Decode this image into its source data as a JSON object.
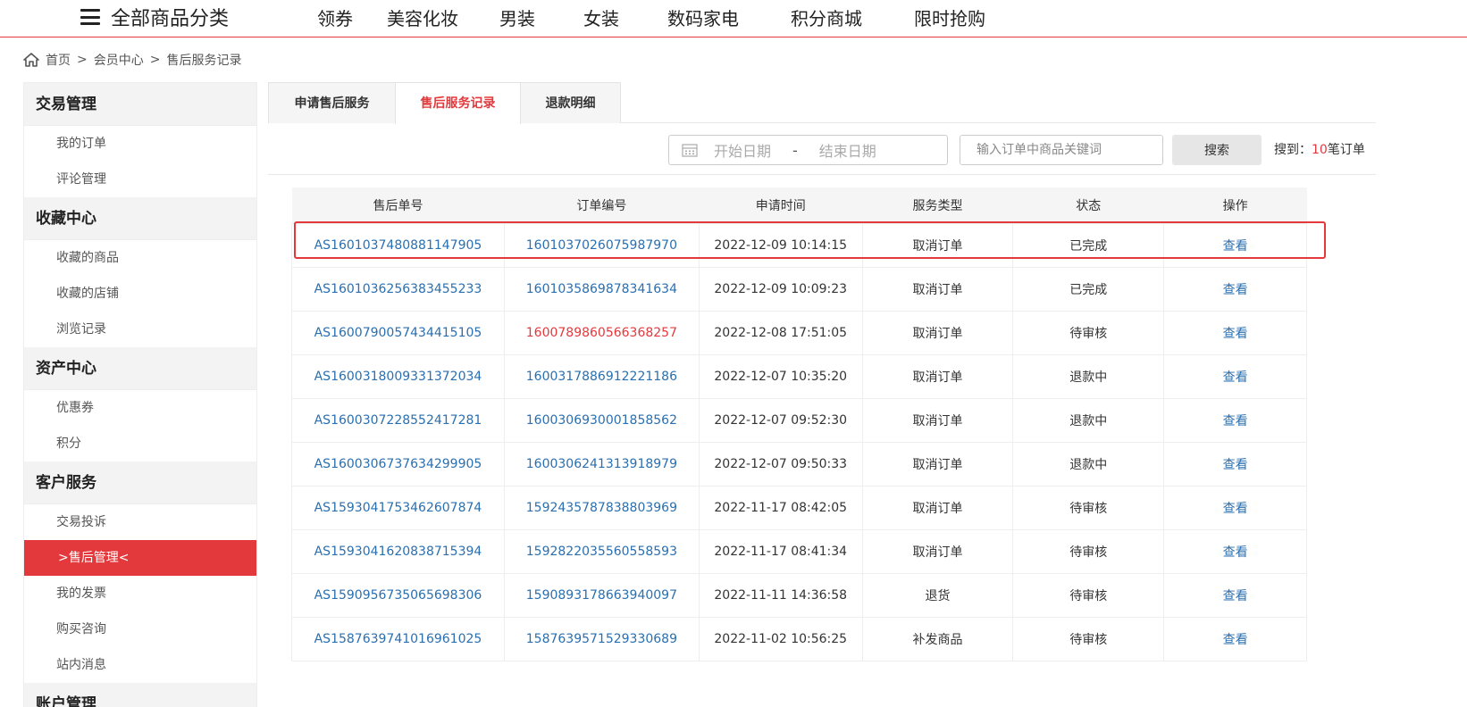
{
  "nav": {
    "category": "全部商品分类",
    "links": [
      "领券",
      "美容化妆",
      "男装",
      "女装",
      "数码家电",
      "积分商城",
      "限时抢购"
    ]
  },
  "breadcrumb": [
    "首页",
    "会员中心",
    "售后服务记录"
  ],
  "sidebar": {
    "groups": [
      {
        "title": "交易管理",
        "items": [
          "我的订单",
          "评论管理"
        ]
      },
      {
        "title": "收藏中心",
        "items": [
          "收藏的商品",
          "收藏的店铺",
          "浏览记录"
        ]
      },
      {
        "title": "资产中心",
        "items": [
          "优惠券",
          "积分"
        ]
      },
      {
        "title": "客户服务",
        "items": [
          "交易投诉",
          ">售后管理<",
          "我的发票",
          "购买咨询",
          "站内消息"
        ]
      },
      {
        "title": "账户管理",
        "items": []
      }
    ],
    "active_item": ">售后管理<"
  },
  "tabs": [
    "申请售后服务",
    "售后服务记录",
    "退款明细"
  ],
  "active_tab": "售后服务记录",
  "filter": {
    "start_placeholder": "开始日期",
    "end_placeholder": "结束日期",
    "keyword_placeholder": "输入订单中商品关键词",
    "search_label": "搜索",
    "found_prefix": "搜到：",
    "found_count": "10",
    "found_suffix": "笔订单"
  },
  "table": {
    "headers": [
      "售后单号",
      "订单编号",
      "申请时间",
      "服务类型",
      "状态",
      "操作"
    ],
    "rows": [
      [
        "AS1601037480881147905",
        "1601037026075987970",
        "2022-12-09 10:14:15",
        "取消订单",
        "已完成",
        "查看"
      ],
      [
        "AS1601036256383455233",
        "1601035869878341634",
        "2022-12-09 10:09:23",
        "取消订单",
        "已完成",
        "查看"
      ],
      [
        "AS1600790057434415105",
        "1600789860566368257",
        "2022-12-08 17:51:05",
        "取消订单",
        "待审核",
        "查看"
      ],
      [
        "AS1600318009331372034",
        "1600317886912221186",
        "2022-12-07 10:35:20",
        "取消订单",
        "退款中",
        "查看"
      ],
      [
        "AS1600307228552417281",
        "1600306930001858562",
        "2022-12-07 09:52:30",
        "取消订单",
        "退款中",
        "查看"
      ],
      [
        "AS1600306737634299905",
        "1600306241313918979",
        "2022-12-07 09:50:33",
        "取消订单",
        "退款中",
        "查看"
      ],
      [
        "AS1593041753462607874",
        "1592435787838803969",
        "2022-11-17 08:42:05",
        "取消订单",
        "待审核",
        "查看"
      ],
      [
        "AS1593041620838715394",
        "1592822035560558593",
        "2022-11-17 08:41:34",
        "取消订单",
        "待审核",
        "查看"
      ],
      [
        "AS1590956735065698306",
        "1590893178663940097",
        "2022-11-11 14:36:58",
        "退货",
        "待审核",
        "查看"
      ],
      [
        "AS1587639741016961025",
        "1587639571529330689",
        "2022-11-02 10:56:25",
        "补发商品",
        "待审核",
        "查看"
      ]
    ],
    "red_order_row": 2
  },
  "colors": {
    "accent": "#e4393c",
    "link": "#2a6fb0"
  }
}
